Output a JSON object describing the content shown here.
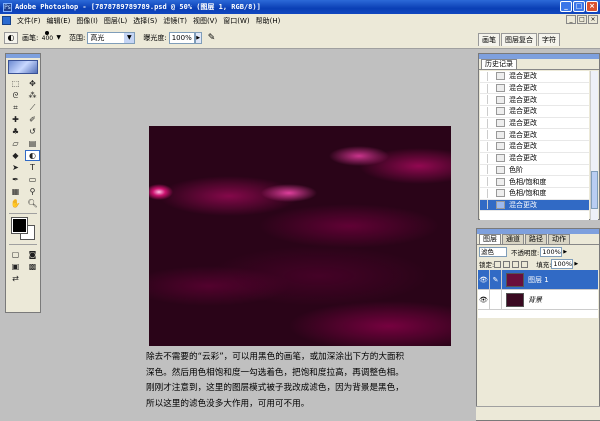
{
  "window": {
    "title": "Adobe Photoshop - [7878789789789.psd @ 50% (图层 1, RGB/8)]",
    "controls": [
      "_",
      "□",
      "×"
    ]
  },
  "menu": {
    "items": [
      "文件(F)",
      "编辑(E)",
      "图像(I)",
      "图层(L)",
      "选择(S)",
      "滤镜(T)",
      "视图(V)",
      "窗口(W)",
      "帮助(H)"
    ],
    "doc_controls": [
      "_",
      "□",
      "×"
    ]
  },
  "options": {
    "brush_label": "画笔:",
    "brush_size": "400",
    "range_label": "范围:",
    "range_value": "高光",
    "exposure_label": "曝光度:",
    "exposure_value": "100%"
  },
  "palette_well": {
    "tabs": [
      "画笔",
      "图层复合",
      "字符"
    ]
  },
  "colors": {
    "foreground": "#000000",
    "background": "#ffffff",
    "accent": "#316ac5",
    "title_bar": "#0a3fb5"
  },
  "history": {
    "tab": "历史记录",
    "rows": [
      {
        "label": "混合更改",
        "active": false
      },
      {
        "label": "混合更改",
        "active": false
      },
      {
        "label": "混合更改",
        "active": false
      },
      {
        "label": "混合更改",
        "active": false
      },
      {
        "label": "混合更改",
        "active": false
      },
      {
        "label": "混合更改",
        "active": false
      },
      {
        "label": "混合更改",
        "active": false
      },
      {
        "label": "混合更改",
        "active": false
      },
      {
        "label": "色阶",
        "active": false
      },
      {
        "label": "色相/饱和度",
        "active": false
      },
      {
        "label": "色相/饱和度",
        "active": false
      },
      {
        "label": "混合更改",
        "active": true
      }
    ]
  },
  "layers": {
    "tabs": [
      "图层",
      "通道",
      "路径",
      "动作"
    ],
    "blend_mode": "滤色",
    "opacity_label": "不透明度:",
    "opacity_value": "100%",
    "lock_label": "锁定:",
    "fill_label": "填充:",
    "fill_value": "100%",
    "items": [
      {
        "name": "图层 1",
        "active": true
      },
      {
        "name": "背景",
        "active": false
      }
    ]
  },
  "caption": {
    "line1": "除去不需要的“云彩”，可以用黑色的画笔，或加深涂出下方的大面积",
    "line2": "深色。然后用色相饱和度一勾选着色，把饱和度拉高，再调整色相。",
    "line3": "刚刚才注意到，这里的图层模式被子我改成滤色，因为背景是黑色，",
    "line4": "所以这里的滤色没多大作用，可用可不用。"
  }
}
